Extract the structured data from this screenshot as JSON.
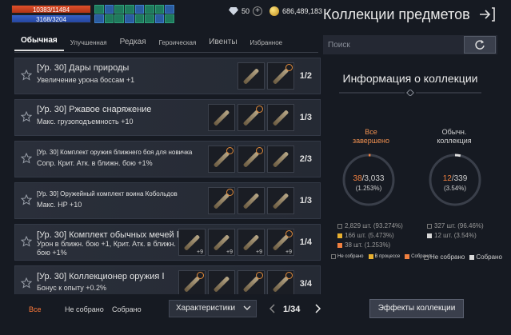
{
  "hud": {
    "hp": "10383/11484",
    "mp": "3168/3204",
    "gems": "50",
    "gold": "686,489,183"
  },
  "page_title": "Коллекции предметов",
  "tabs": [
    {
      "label": "Обычная",
      "active": true
    },
    {
      "label": "Улучшенная"
    },
    {
      "label": "Редкая"
    },
    {
      "label": "Героическая"
    },
    {
      "label": "Ивенты"
    },
    {
      "label": "Избранное"
    }
  ],
  "search": {
    "placeholder": "Поиск"
  },
  "rows": [
    {
      "title": "[Ур. 30] Дары природы",
      "desc": "Увеличение урона боссам +1",
      "count": "1/2"
    },
    {
      "title": "[Ур. 30] Ржавое снаряжение",
      "desc": "Макс. грузоподъемность +10",
      "count": "1/3"
    },
    {
      "title": "[Ур. 30] Комплект оружия ближнего боя для новичка",
      "desc": "Сопр. Крит. Атк. в ближн. бою +1%",
      "count": "2/3"
    },
    {
      "title": "[Ур. 30] Оружейный комплект воина Кобольдов",
      "desc": "Макс. HP +10",
      "count": "1/3"
    },
    {
      "title": "[Ур. 30] Комплект обычных мечей Ⅱ",
      "desc": "Урон в ближн. бою +1, Крит. Атк. в ближн. бою +1%",
      "count": "1/4"
    },
    {
      "title": "[Ур. 30] Коллекционер оружия Ⅰ",
      "desc": "Бонус к опыту +0.2%",
      "count": "3/4"
    }
  ],
  "item_badge": "+9",
  "bottom": {
    "filter_all": "Все",
    "filter_not_collected": "Не собрано",
    "filter_collected": "Собрано",
    "dropdown": "Характеристики",
    "page": "1/34"
  },
  "info": {
    "title": "Информация о коллекции",
    "all": {
      "label": "Все завершено",
      "done": "38",
      "total": "/3,033",
      "pct": "(1.253%)",
      "fraction": 0.01253,
      "legend": [
        "2,829 шт. (93.274%)",
        "166 шт. (5.473%)",
        "38 шт. (1.253%)"
      ]
    },
    "normal": {
      "label": "Обычн. коллекция",
      "done": "12",
      "total": "/339",
      "pct": "(3.54%)",
      "fraction": 0.0354,
      "legend": [
        "327 шт. (96.46%)",
        "12 шт. (3.54%)"
      ]
    },
    "keys_left": [
      "Не собрано",
      "В процессе",
      "Собрано"
    ],
    "keys_right": [
      "Не собрано",
      "Собрано"
    ],
    "effects_button": "Эффекты коллекции"
  },
  "colors": {
    "accent_orange": "#f08040",
    "ring_track": "#3a3f4a",
    "active_filter": "#ff7a3a"
  }
}
